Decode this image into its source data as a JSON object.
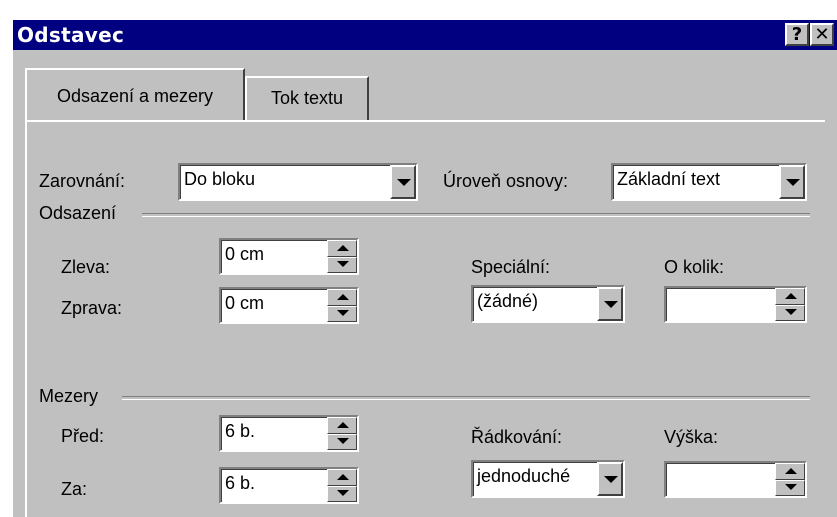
{
  "window": {
    "title": "Odstavec",
    "help_label": "?",
    "close_label": "✕"
  },
  "tabs": [
    {
      "label": "Odsazení a mezery",
      "active": true
    },
    {
      "label": "Tok textu",
      "active": false
    }
  ],
  "general": {
    "alignment_label": "Zarovnání:",
    "alignment_value": "Do bloku",
    "outline_label": "Úroveň osnovy:",
    "outline_value": "Základní text"
  },
  "indent": {
    "group_label": "Odsazení",
    "left_label": "Zleva:",
    "left_value": "0 cm",
    "right_label": "Zprava:",
    "right_value": "0 cm",
    "special_label": "Speciální:",
    "special_value": "(žádné)",
    "by_label": "O kolik:",
    "by_value": ""
  },
  "spacing": {
    "group_label": "Mezery",
    "before_label": "Před:",
    "before_value": "6 b.",
    "after_label": "Za:",
    "after_value": "6 b.",
    "line_label": "Řádkování:",
    "line_value": "jednoduché",
    "at_label": "Výška:",
    "at_value": ""
  },
  "colors": {
    "titlebar": "#000080",
    "face": "#c0c0c0"
  }
}
